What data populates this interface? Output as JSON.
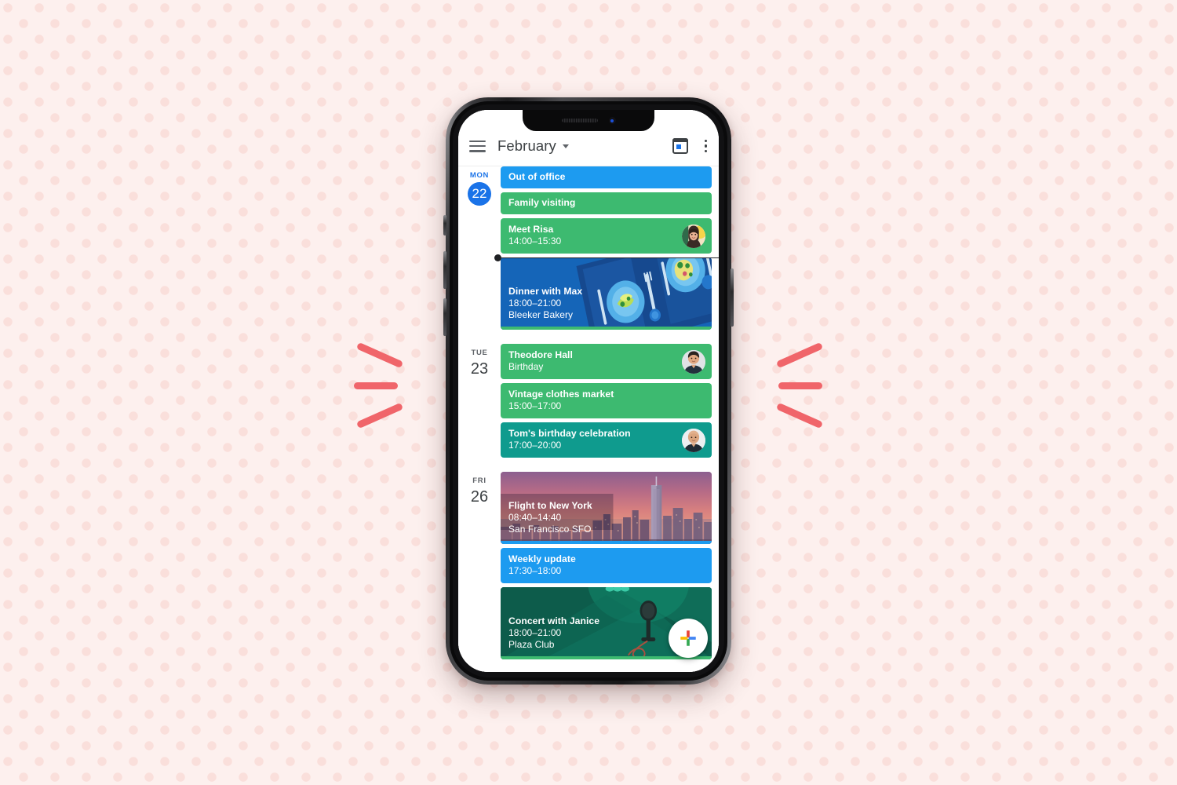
{
  "background": {
    "base_color": "#fdf0ee",
    "dot_color": "#fadfdb",
    "accent_mark_color": "#f0656a"
  },
  "appbar": {
    "menu_icon": "hamburger-menu-icon",
    "title": "February",
    "dropdown_icon": "chevron-down-icon",
    "calendar_icon": "calendar-today-icon",
    "overflow_icon": "more-vertical-icon"
  },
  "colors": {
    "event_blue": "#1d9bf0",
    "event_green": "#3dba70",
    "event_teal": "#0f9b8e",
    "event_dark_blue": "#1565b8",
    "today_blue": "#1a73e8",
    "concert_green": "#0d5c4b"
  },
  "days": [
    {
      "dow": "MON",
      "day": "22",
      "is_today": true,
      "events": [
        {
          "title": "Out of office",
          "time": "",
          "location": "",
          "style": "blue",
          "avatar": null,
          "media": null
        },
        {
          "title": "Family visiting",
          "time": "",
          "location": "",
          "style": "green",
          "avatar": null,
          "media": null
        },
        {
          "title": "Meet Risa",
          "time": "14:00–15:30",
          "location": "",
          "style": "green",
          "avatar": "woman-avatar",
          "media": null
        },
        {
          "title": "Dinner with Max",
          "time": "18:00–21:00",
          "location": "Bleeker Bakery",
          "style": "darkblue",
          "avatar": null,
          "media": "dinner-table-photo"
        }
      ]
    },
    {
      "dow": "TUE",
      "day": "23",
      "is_today": false,
      "events": [
        {
          "title": "Theodore Hall",
          "time": "Birthday",
          "location": "",
          "style": "green",
          "avatar": "man-avatar",
          "media": null
        },
        {
          "title": "Vintage clothes market",
          "time": "15:00–17:00",
          "location": "",
          "style": "green",
          "avatar": null,
          "media": null
        },
        {
          "title": "Tom's birthday celebration",
          "time": "17:00–20:00",
          "location": "",
          "style": "teal",
          "avatar": "bald-man-avatar",
          "media": null
        }
      ]
    },
    {
      "dow": "FRI",
      "day": "26",
      "is_today": false,
      "events": [
        {
          "title": "Flight to New York",
          "time": "08:40–14:40",
          "location": "San Francisco SFO",
          "style": "photo",
          "avatar": null,
          "media": "new-york-skyline-photo"
        },
        {
          "title": "Weekly update",
          "time": "17:30–18:00",
          "location": "",
          "style": "blue",
          "avatar": null,
          "media": null
        },
        {
          "title": "Concert with Janice",
          "time": "18:00–21:00",
          "location": "Plaza Club",
          "style": "concert",
          "avatar": null,
          "media": "concert-microphone-illustration"
        }
      ]
    }
  ],
  "fab": {
    "label": "+",
    "icon": "google-plus-create-icon"
  }
}
